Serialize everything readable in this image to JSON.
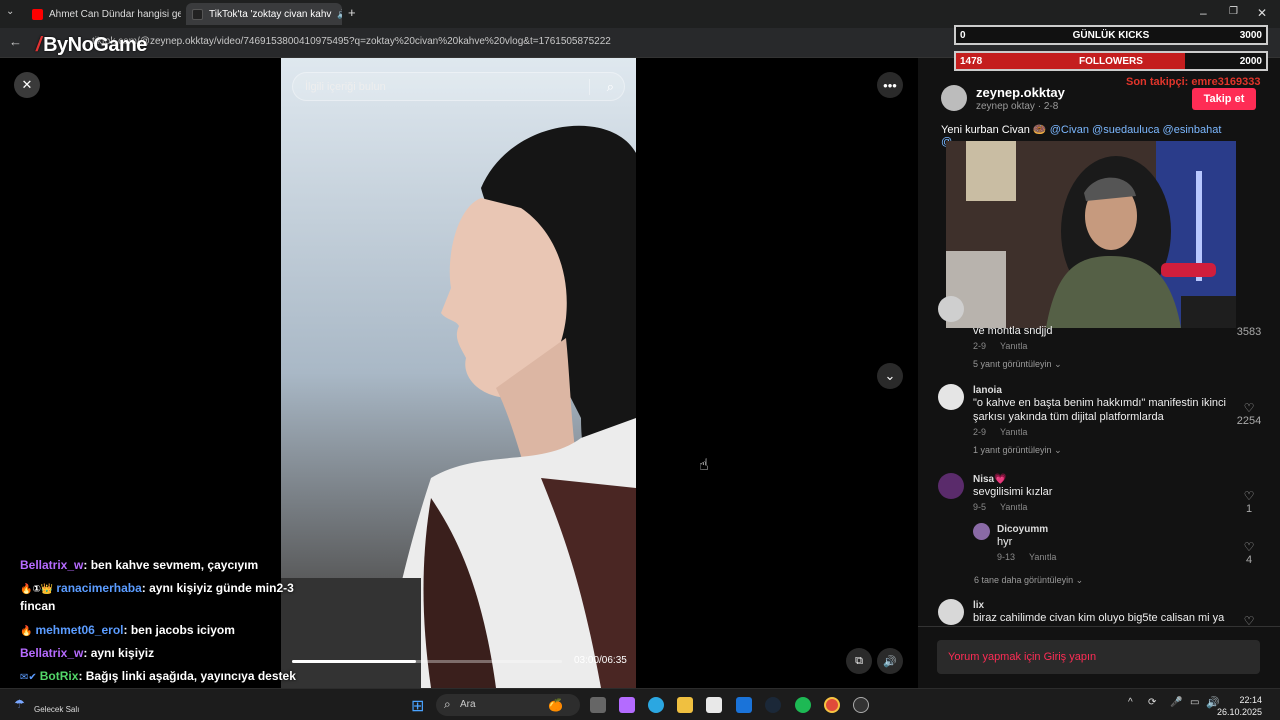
{
  "browser": {
    "tabs": [
      {
        "title": "Ahmet Can Dündar hangisi gel",
        "favicon_color": "#ff0000"
      },
      {
        "title": "TikTok'ta 'zoktay civan kahv",
        "favicon_color": "#222222"
      }
    ],
    "new_tab": "+",
    "url": "tiktok.com/@zeynep.okktay/video/7469153800410975495?q=zoktay%20civan%20kahve%20vlog&t=1761505875222"
  },
  "overlay": {
    "logo": "ByNoGame",
    "kicks_label": "GÜNLÜK KICKS",
    "kicks_current": "0",
    "kicks_goal": "3000",
    "kicks_fraction": 0.0,
    "followers_label": "FOLLOWERS",
    "followers_current": "1478",
    "followers_goal": "2000",
    "followers_fraction": 0.739,
    "last_follower": "Son takipçi: emre3169333"
  },
  "video": {
    "search_placeholder": "İlgili içeriği bulun",
    "time": "03:00/06:35",
    "progress_fraction": 0.46
  },
  "chat": [
    {
      "user": "Bellatrix_w",
      "user_color": "#b66bff",
      "badges": "",
      "text": ": ben kahve sevmem, çaycıyım"
    },
    {
      "user": "ranacimerhaba",
      "user_color": "#5b9cff",
      "badges": "🔥①👑",
      "text": ": aynı kişiyiz günde min2-3 fincan"
    },
    {
      "user": "mehmet06_erol",
      "user_color": "#5b9cff",
      "badges": "🔥",
      "text": ": ben jacobs iciyom"
    },
    {
      "user": "Bellatrix_w",
      "user_color": "#b66bff",
      "badges": "",
      "text": ": aynı kişiyiz"
    },
    {
      "user": "BotRix",
      "user_color": "#53d769",
      "badges": "✉✔",
      "text": ": Bağış linki aşağıda, yayıncıya destek olmayı unutma!"
    }
  ],
  "post": {
    "username": "zeynep.okktay",
    "subline": "zeynep oktay · 2-8",
    "follow_label": "Takip et",
    "caption_prefix": "Yeni kurban Civan 🍩",
    "mentions": "@Civan @suedauluca @esinbahat",
    "caption_cut": "@..."
  },
  "comments": [
    {
      "name": "",
      "text": "ve montla sndjjd",
      "date": "2-9",
      "reply": "Yanıtla",
      "likes": "3583",
      "view_replies": "5 yanıt görüntüleyin"
    },
    {
      "name": "lanoia",
      "text": "\"o kahve en başta benim hakkımdı\" manifestin ikinci şarkısı yakında tüm dijital platformlarda",
      "date": "2-9",
      "reply": "Yanıtla",
      "likes": "2254",
      "view_replies": "1 yanıt görüntüleyin"
    },
    {
      "name": "Nisa💗",
      "text": "sevgilisimi kızlar",
      "date": "9-5",
      "reply": "Yanıtla",
      "likes": "1",
      "view_replies": ""
    },
    {
      "name": "Dicoyumm",
      "text": "hyr",
      "date": "9-13",
      "reply": "Yanıtla",
      "likes": "4",
      "view_replies": "6 tane daha görüntüleyin"
    },
    {
      "name": "lix",
      "text": "biraz cahilimde civan kim oluyo big5te calisan mi ya",
      "date": "",
      "reply": "",
      "likes": "",
      "view_replies": ""
    }
  ],
  "login_prompt": "Yorum yapmak için Giriş yapın",
  "taskbar": {
    "weather_line1": "Gelecek Salı",
    "search_label": "Ara",
    "time": "22:14",
    "date": "26.10.2025"
  }
}
